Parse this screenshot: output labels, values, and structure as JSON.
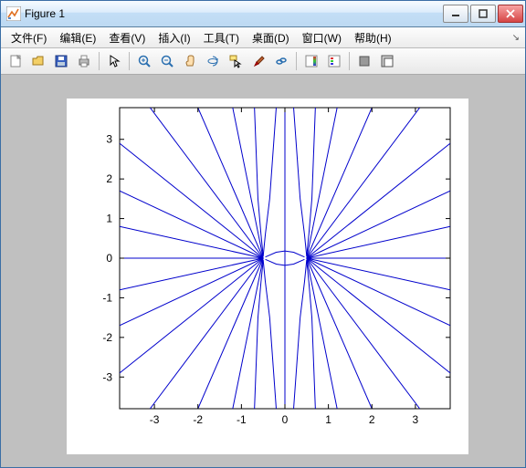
{
  "window": {
    "title": "Figure 1"
  },
  "menus": {
    "file": "文件(F)",
    "edit": "编辑(E)",
    "view": "查看(V)",
    "insert": "插入(I)",
    "tools": "工具(T)",
    "desktop": "桌面(D)",
    "window": "窗口(W)",
    "help": "帮助(H)"
  },
  "toolbar": {
    "new": "new-figure",
    "open": "open-file",
    "save": "save-figure",
    "print": "print-figure",
    "pointer": "edit-plot",
    "zoom_in": "zoom-in",
    "zoom_out": "zoom-out",
    "pan": "pan",
    "rotate": "rotate-3d",
    "cursor": "data-cursor",
    "brush": "brush",
    "link": "link-plot",
    "colorbar": "insert-colorbar",
    "legend": "insert-legend",
    "hide": "hide-tools",
    "dock": "dock-figure"
  },
  "chart_data": {
    "type": "line",
    "title": "",
    "xlabel": "",
    "ylabel": "",
    "xlim": [
      -3.8,
      3.8
    ],
    "ylim": [
      -3.8,
      3.8
    ],
    "xticks": [
      -3,
      -2,
      -1,
      0,
      1,
      2,
      3
    ],
    "yticks": [
      -3,
      -2,
      -1,
      0,
      1,
      2,
      3
    ],
    "description": "Contour/field lines of a two-dimensional dipole: two singular points at approximately (-0.5, 0) and (0.5, 0). Straight rays emanate outward from each singular point toward the plot boundary; curved lines connect the region near the two points and fan upward/downward. All curves drawn in MATLAB default blue.",
    "singularities": [
      [
        -0.5,
        0
      ],
      [
        0.5,
        0
      ]
    ],
    "line_color": "#0000cc",
    "series": [
      {
        "name": "ray",
        "from": [
          -0.5,
          0
        ],
        "to": [
          -3.8,
          0
        ]
      },
      {
        "name": "ray",
        "from": [
          -0.5,
          0
        ],
        "to": [
          -3.8,
          0.8
        ]
      },
      {
        "name": "ray",
        "from": [
          -0.5,
          0
        ],
        "to": [
          -3.8,
          1.7
        ]
      },
      {
        "name": "ray",
        "from": [
          -0.5,
          0
        ],
        "to": [
          -3.8,
          2.9
        ]
      },
      {
        "name": "ray",
        "from": [
          -0.5,
          0
        ],
        "to": [
          -3.1,
          3.8
        ]
      },
      {
        "name": "ray",
        "from": [
          -0.5,
          0
        ],
        "to": [
          -2.0,
          3.8
        ]
      },
      {
        "name": "ray",
        "from": [
          -0.5,
          0
        ],
        "to": [
          -1.2,
          3.8
        ]
      },
      {
        "name": "ray",
        "from": [
          -0.5,
          0
        ],
        "to": [
          -3.8,
          -0.8
        ]
      },
      {
        "name": "ray",
        "from": [
          -0.5,
          0
        ],
        "to": [
          -3.8,
          -1.7
        ]
      },
      {
        "name": "ray",
        "from": [
          -0.5,
          0
        ],
        "to": [
          -3.8,
          -2.9
        ]
      },
      {
        "name": "ray",
        "from": [
          -0.5,
          0
        ],
        "to": [
          -3.1,
          -3.8
        ]
      },
      {
        "name": "ray",
        "from": [
          -0.5,
          0
        ],
        "to": [
          -2.0,
          -3.8
        ]
      },
      {
        "name": "ray",
        "from": [
          -0.5,
          0
        ],
        "to": [
          -1.2,
          -3.8
        ]
      },
      {
        "name": "ray",
        "from": [
          0.5,
          0
        ],
        "to": [
          3.8,
          0
        ]
      },
      {
        "name": "ray",
        "from": [
          0.5,
          0
        ],
        "to": [
          3.8,
          0.8
        ]
      },
      {
        "name": "ray",
        "from": [
          0.5,
          0
        ],
        "to": [
          3.8,
          1.7
        ]
      },
      {
        "name": "ray",
        "from": [
          0.5,
          0
        ],
        "to": [
          3.8,
          2.9
        ]
      },
      {
        "name": "ray",
        "from": [
          0.5,
          0
        ],
        "to": [
          3.1,
          3.8
        ]
      },
      {
        "name": "ray",
        "from": [
          0.5,
          0
        ],
        "to": [
          2.0,
          3.8
        ]
      },
      {
        "name": "ray",
        "from": [
          0.5,
          0
        ],
        "to": [
          1.2,
          3.8
        ]
      },
      {
        "name": "ray",
        "from": [
          0.5,
          0
        ],
        "to": [
          3.8,
          -0.8
        ]
      },
      {
        "name": "ray",
        "from": [
          0.5,
          0
        ],
        "to": [
          3.8,
          -1.7
        ]
      },
      {
        "name": "ray",
        "from": [
          0.5,
          0
        ],
        "to": [
          3.8,
          -2.9
        ]
      },
      {
        "name": "ray",
        "from": [
          0.5,
          0
        ],
        "to": [
          3.1,
          -3.8
        ]
      },
      {
        "name": "ray",
        "from": [
          0.5,
          0
        ],
        "to": [
          2.0,
          -3.8
        ]
      },
      {
        "name": "ray",
        "from": [
          0.5,
          0
        ],
        "to": [
          1.2,
          -3.8
        ]
      },
      {
        "name": "vline",
        "x": 0,
        "from": -3.8,
        "to": 3.8
      },
      {
        "name": "curve",
        "pts": [
          [
            -0.5,
            0.05
          ],
          [
            -0.55,
            0.6
          ],
          [
            -0.62,
            1.5
          ],
          [
            -0.7,
            3.8
          ]
        ]
      },
      {
        "name": "curve",
        "pts": [
          [
            -0.5,
            0.05
          ],
          [
            -0.45,
            0.6
          ],
          [
            -0.35,
            1.5
          ],
          [
            -0.2,
            3.8
          ]
        ]
      },
      {
        "name": "curve",
        "pts": [
          [
            0.5,
            0.05
          ],
          [
            0.45,
            0.6
          ],
          [
            0.35,
            1.5
          ],
          [
            0.2,
            3.8
          ]
        ]
      },
      {
        "name": "curve",
        "pts": [
          [
            0.5,
            0.05
          ],
          [
            0.55,
            0.6
          ],
          [
            0.62,
            1.5
          ],
          [
            0.7,
            3.8
          ]
        ]
      },
      {
        "name": "curve",
        "pts": [
          [
            -0.5,
            -0.05
          ],
          [
            -0.55,
            -0.6
          ],
          [
            -0.62,
            -1.5
          ],
          [
            -0.7,
            -3.8
          ]
        ]
      },
      {
        "name": "curve",
        "pts": [
          [
            -0.5,
            -0.05
          ],
          [
            -0.45,
            -0.6
          ],
          [
            -0.35,
            -1.5
          ],
          [
            -0.2,
            -3.8
          ]
        ]
      },
      {
        "name": "curve",
        "pts": [
          [
            0.5,
            -0.05
          ],
          [
            0.45,
            -0.6
          ],
          [
            0.35,
            -1.5
          ],
          [
            0.2,
            -3.8
          ]
        ]
      },
      {
        "name": "curve",
        "pts": [
          [
            0.5,
            -0.05
          ],
          [
            0.55,
            -0.6
          ],
          [
            0.62,
            -1.5
          ],
          [
            0.7,
            -3.8
          ]
        ]
      },
      {
        "name": "curve",
        "pts": [
          [
            -0.45,
            0.03
          ],
          [
            -0.2,
            0.15
          ],
          [
            0.0,
            0.18
          ],
          [
            0.2,
            0.15
          ],
          [
            0.45,
            0.03
          ]
        ]
      },
      {
        "name": "curve",
        "pts": [
          [
            -0.45,
            -0.03
          ],
          [
            -0.2,
            -0.15
          ],
          [
            0.0,
            -0.18
          ],
          [
            0.2,
            -0.15
          ],
          [
            0.45,
            -0.03
          ]
        ]
      }
    ]
  }
}
